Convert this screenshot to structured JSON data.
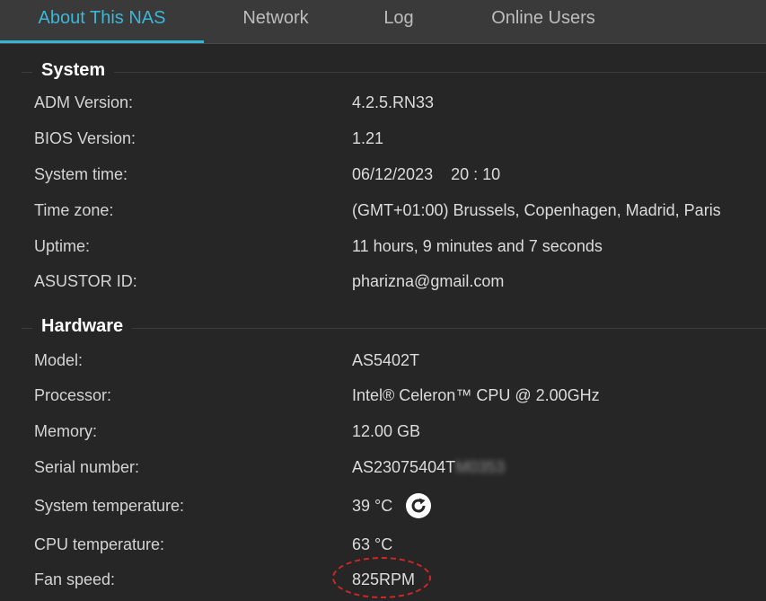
{
  "tabs": [
    {
      "label": "About This NAS",
      "active": true
    },
    {
      "label": "Network",
      "active": false
    },
    {
      "label": "Log",
      "active": false
    },
    {
      "label": "Online Users",
      "active": false
    }
  ],
  "system": {
    "title": "System",
    "rows": [
      {
        "label": "ADM Version:",
        "value": "4.2.5.RN33"
      },
      {
        "label": "BIOS Version:",
        "value": "1.21"
      },
      {
        "label": "System time:",
        "value": "06/12/2023    20 : 10"
      },
      {
        "label": "Time zone:",
        "value": "(GMT+01:00) Brussels, Copenhagen, Madrid, Paris"
      },
      {
        "label": "Uptime:",
        "value": "11 hours, 9 minutes and 7 seconds"
      },
      {
        "label": "ASUSTOR ID:",
        "value": "pharizna@gmail.com"
      }
    ]
  },
  "hardware": {
    "title": "Hardware",
    "rows": [
      {
        "label": "Model:",
        "value": "AS5402T"
      },
      {
        "label": "Processor:",
        "value": "Intel® Celeron™ CPU @ 2.00GHz"
      },
      {
        "label": "Memory:",
        "value": "12.00 GB"
      },
      {
        "label": "Serial number:",
        "value": "AS23075404T",
        "value_blurred": "M0353"
      },
      {
        "label": "System temperature:",
        "value": "39 °C"
      },
      {
        "label": "CPU temperature:",
        "value": "63 °C"
      },
      {
        "label": "Fan speed:",
        "value": "825RPM"
      }
    ]
  },
  "icons": {
    "refresh": "refresh-icon"
  },
  "colors": {
    "accent": "#36b4d6",
    "highlight": "#d32626",
    "background": "#262626"
  }
}
